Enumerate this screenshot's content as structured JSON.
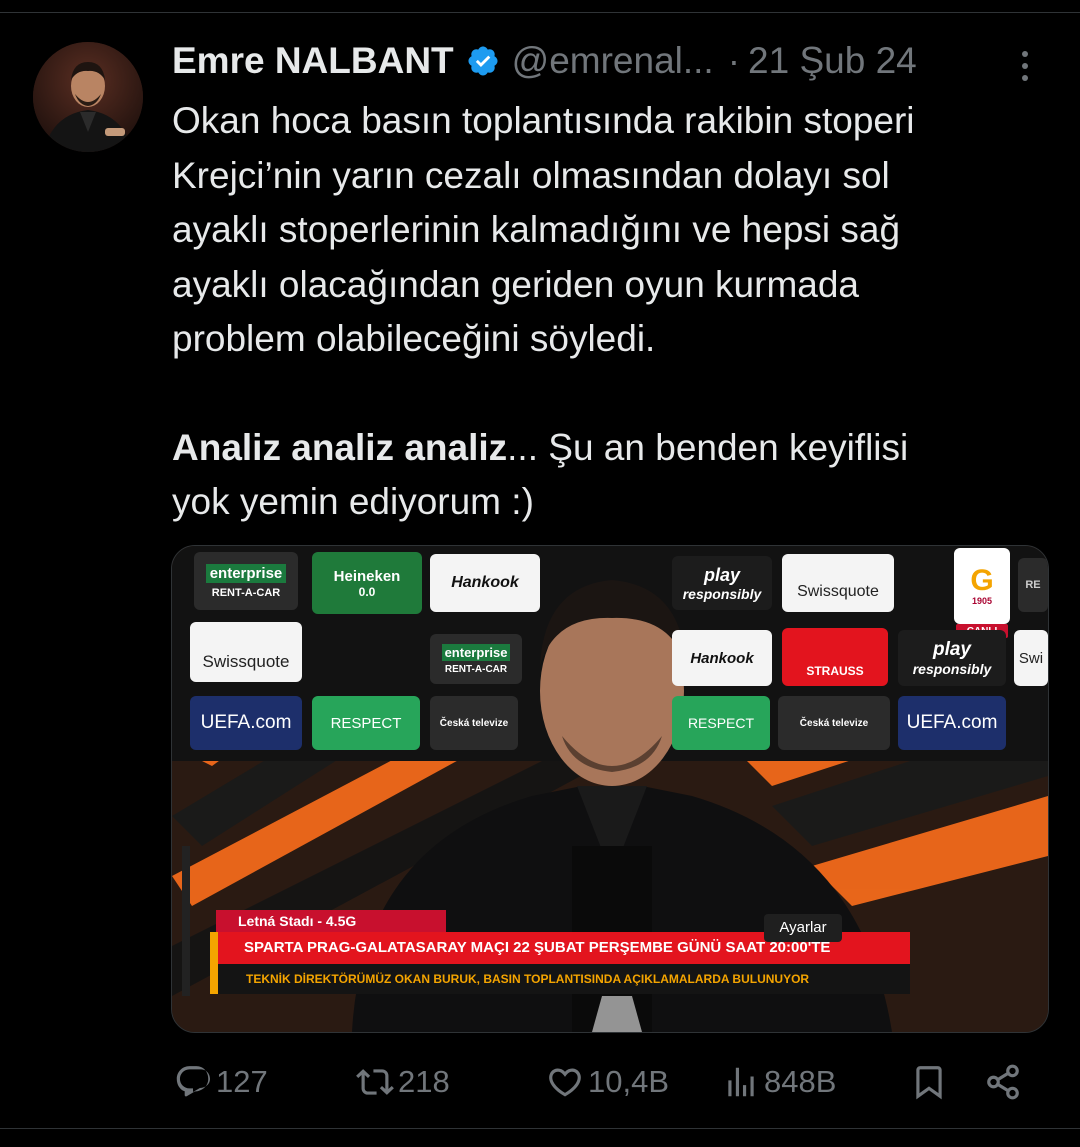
{
  "tweet": {
    "author": {
      "name": "Emre NALBANT",
      "handle": "@emrenal...",
      "verified": true
    },
    "separator": "·",
    "date": "21 Şub 24",
    "text_lines": [
      "Okan hoca basın toplantısında rakibin stoperi",
      "Krejci’nin yarın cezalı olmasından dolayı sol",
      "ayaklı stoperlerinin kalmadığını ve hepsi sağ",
      "ayaklı olacağından geriden oyun kurmada",
      "problem olabileceğini söyledi."
    ],
    "text2_bold": "Analiz analiz analiz",
    "text2_rest_line1": "... Şu an benden keyiflisi",
    "text2_line2": "yok yemin ediyorum :)",
    "media": {
      "backdrop": {
        "enterprise": "enterprise",
        "rent_a_car": "RENT-A-CAR",
        "heineken": "Heineken",
        "heineken_sub": "0.0",
        "hankook": "Hankook",
        "play": "play",
        "responsibly": "responsibly",
        "swissquote": "Swissquote",
        "uefa": "UEFA.com",
        "respect": "RESPECT",
        "ceska": "Česká televize",
        "strauss": "STRAUSS",
        "gs_year": "1905",
        "canli": "CANLI",
        "swi_cut": "Swi",
        "re_cut": "RE"
      },
      "location": "Letná Stadı - 4.5G",
      "headline_a": "SPARTA PRAG-GALATASARAY MAÇI 22 ŞUBAT PERŞEMBE GÜNÜ ",
      "headline_b": "SAAT 20:00'TE",
      "subline": "TEKNİK DİREKTÖRÜMÜZ OKAN BURUK, BASIN TOPLANTISINDA AÇIKLAMALARDA BULUNUYOR",
      "settings_tooltip": "Ayarlar"
    },
    "stats": {
      "replies": "127",
      "reposts": "218",
      "likes": "10,4B",
      "views": "848B"
    }
  },
  "colors": {
    "background": "#000000",
    "text": "#e7e9ea",
    "muted": "#71767b",
    "verified": "#1d9bf0",
    "uel_orange": "#f26a1b",
    "banner_red": "#e3141e"
  }
}
